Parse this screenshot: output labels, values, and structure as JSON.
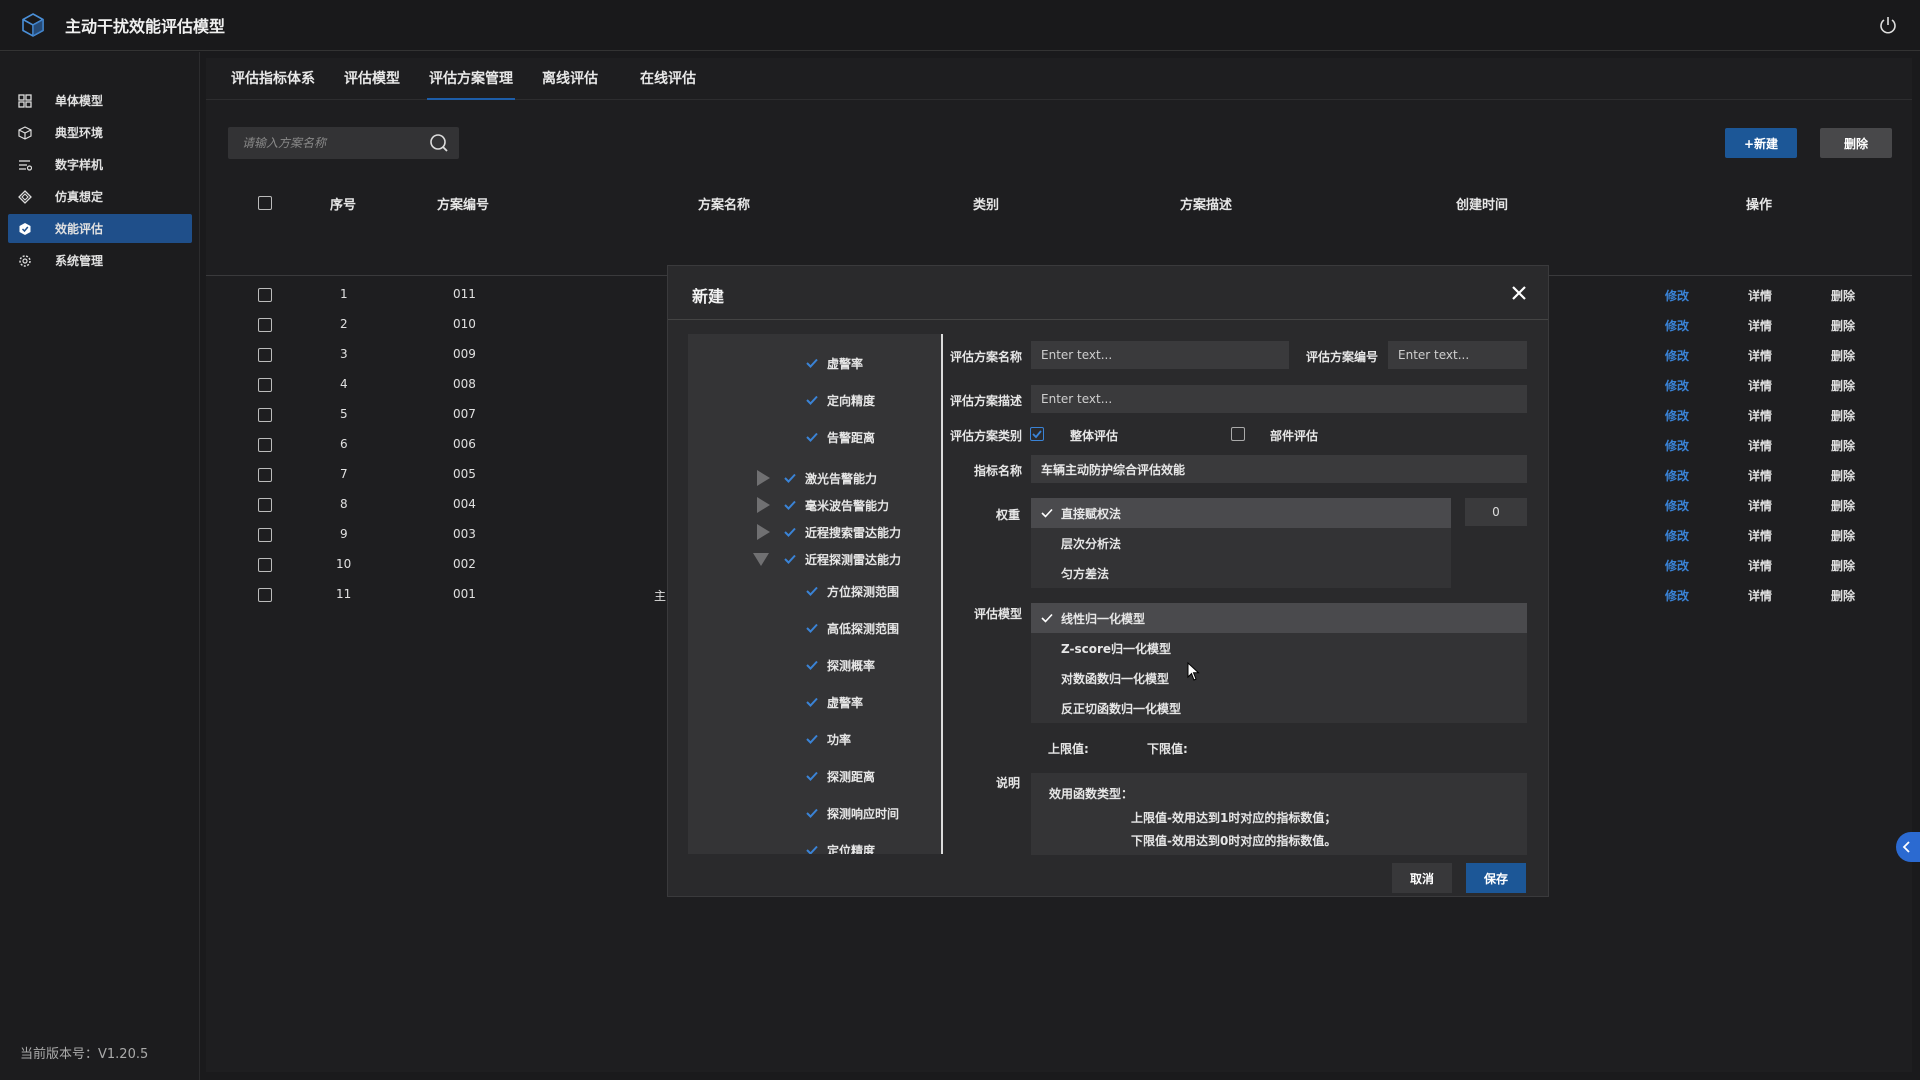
{
  "app": {
    "title": "主动干扰效能评估模型",
    "version": "当前版本号：V1.20.5"
  },
  "sidebar": {
    "items": [
      {
        "label": "单体模型",
        "icon": "grid-icon"
      },
      {
        "label": "典型环境",
        "icon": "cube-icon"
      },
      {
        "label": "数字样机",
        "icon": "list-gear-icon"
      },
      {
        "label": "仿真想定",
        "icon": "diamond-icon"
      },
      {
        "label": "效能评估",
        "icon": "shield-check-icon",
        "active": true
      },
      {
        "label": "系统管理",
        "icon": "gear-icon"
      }
    ]
  },
  "tabs": [
    {
      "label": "评估指标体系"
    },
    {
      "label": "评估模型"
    },
    {
      "label": "评估方案管理",
      "active": true
    },
    {
      "label": "离线评估"
    },
    {
      "label": "在线评估"
    }
  ],
  "search": {
    "placeholder": "请输入方案名称"
  },
  "toolbar": {
    "new_label": "+新建",
    "delete_label": "删除"
  },
  "table": {
    "headers": {
      "index": "序号",
      "code": "方案编号",
      "name": "方案名称",
      "category": "类别",
      "desc": "方案描述",
      "created": "创建时间",
      "ops": "操作"
    },
    "ops": {
      "edit": "修改",
      "detail": "详情",
      "delete": "删除"
    },
    "rows": [
      {
        "index": "1",
        "code": "011",
        "name": ""
      },
      {
        "index": "2",
        "code": "010",
        "name": ""
      },
      {
        "index": "3",
        "code": "009",
        "name": ""
      },
      {
        "index": "4",
        "code": "008",
        "name": ""
      },
      {
        "index": "5",
        "code": "007",
        "name": ""
      },
      {
        "index": "6",
        "code": "006",
        "name": ""
      },
      {
        "index": "7",
        "code": "005",
        "name": ""
      },
      {
        "index": "8",
        "code": "004",
        "name": ""
      },
      {
        "index": "9",
        "code": "003",
        "name": ""
      },
      {
        "index": "10",
        "code": "002",
        "name": ""
      },
      {
        "index": "11",
        "code": "001",
        "name": "主"
      }
    ]
  },
  "modal": {
    "title": "新建",
    "tree": [
      {
        "label": "虚警率",
        "level": 2
      },
      {
        "label": "定向精度",
        "level": 2
      },
      {
        "label": "告警距离",
        "level": 2
      },
      {
        "label": "激光告警能力",
        "level": 1,
        "expander": "collapsed"
      },
      {
        "label": "毫米波告警能力",
        "level": 1,
        "expander": "collapsed"
      },
      {
        "label": "近程搜索雷达能力",
        "level": 1,
        "expander": "collapsed"
      },
      {
        "label": "近程探测雷达能力",
        "level": 1,
        "expander": "expanded"
      },
      {
        "label": "方位探测范围",
        "level": 2
      },
      {
        "label": "高低探测范围",
        "level": 2
      },
      {
        "label": "探测概率",
        "level": 2
      },
      {
        "label": "虚警率",
        "level": 2
      },
      {
        "label": "功率",
        "level": 2
      },
      {
        "label": "探测距离",
        "level": 2
      },
      {
        "label": "探测响应时间",
        "level": 2
      },
      {
        "label": "定位精度",
        "level": 2
      }
    ],
    "form": {
      "name_label": "评估方案名称",
      "name_placeholder": "Enter text...",
      "code_label": "评估方案编号",
      "code_placeholder": "Enter text...",
      "desc_label": "评估方案描述",
      "desc_placeholder": "Enter text...",
      "category_label": "评估方案类别",
      "category_options": [
        {
          "label": "整体评估",
          "checked": true
        },
        {
          "label": "部件评估",
          "checked": false
        }
      ],
      "indicator_label": "指标名称",
      "indicator_value": "车辆主动防护综合评估效能",
      "weight_label": "权重",
      "weight_options": [
        {
          "label": "直接赋权法",
          "selected": true
        },
        {
          "label": "层次分析法",
          "selected": false
        },
        {
          "label": "匀方差法",
          "selected": false
        }
      ],
      "weight_value": "0",
      "model_label": "评估模型",
      "model_options": [
        {
          "label": "线性归一化模型",
          "selected": true
        },
        {
          "label": "Z-score归一化模型",
          "selected": false
        },
        {
          "label": "对数函数归一化模型",
          "selected": false
        },
        {
          "label": "反正切函数归一化模型",
          "selected": false
        }
      ],
      "upper_label": "上限值:",
      "lower_label": "下限值:",
      "note_label": "说明",
      "note_lines": [
        "效用函数类型：",
        "上限值-效用达到1时对应的指标数值；",
        "下限值-效用达到0时对应的指标数值。"
      ]
    },
    "cancel_label": "取消",
    "save_label": "保存"
  },
  "colors": {
    "accent": "#1c5797",
    "link": "#3a83d6",
    "active_side": "#1f4f8a"
  }
}
